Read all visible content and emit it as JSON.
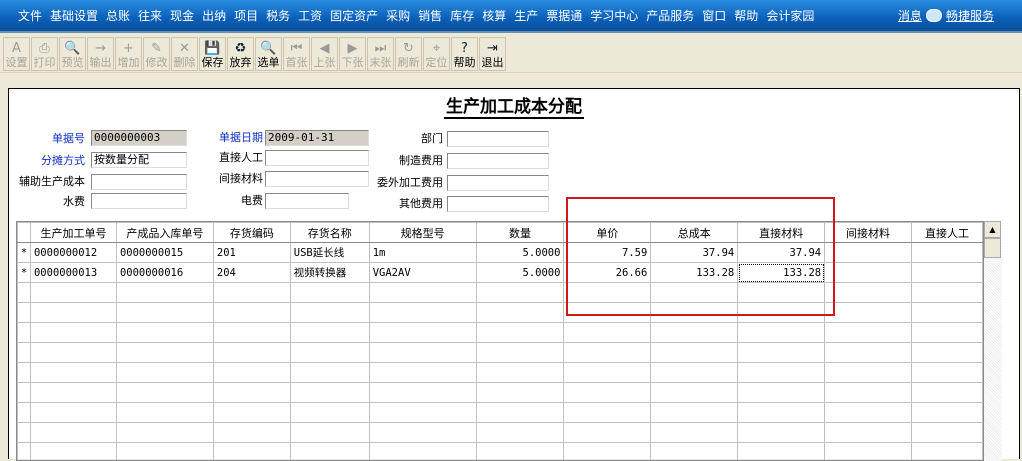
{
  "menu": [
    "文件",
    "基础设置",
    "总账",
    "往来",
    "现金",
    "出纳",
    "项目",
    "税务",
    "工资",
    "固定资产",
    "采购",
    "销售",
    "库存",
    "核算",
    "生产",
    "票据通",
    "学习中心",
    "产品服务",
    "窗口",
    "帮助",
    "会计家园"
  ],
  "menu_right": {
    "message": "消息",
    "service": "畅捷服务"
  },
  "toolbar": [
    {
      "label": "设置",
      "icon": "A",
      "enabled": false
    },
    {
      "label": "打印",
      "icon": "⎙",
      "enabled": false
    },
    {
      "label": "预览",
      "icon": "🔍",
      "enabled": false
    },
    {
      "label": "输出",
      "icon": "→",
      "enabled": false
    },
    {
      "label": "增加",
      "icon": "+",
      "enabled": false
    },
    {
      "label": "修改",
      "icon": "✎",
      "enabled": false
    },
    {
      "label": "删除",
      "icon": "✕",
      "enabled": false
    },
    {
      "label": "保存",
      "icon": "💾",
      "enabled": true
    },
    {
      "label": "放弃",
      "icon": "♻",
      "enabled": true
    },
    {
      "label": "选单",
      "icon": "🔍",
      "enabled": true
    },
    {
      "label": "首张",
      "icon": "⏮",
      "enabled": false
    },
    {
      "label": "上张",
      "icon": "◀",
      "enabled": false
    },
    {
      "label": "下张",
      "icon": "▶",
      "enabled": false
    },
    {
      "label": "末张",
      "icon": "⏭",
      "enabled": false
    },
    {
      "label": "刷新",
      "icon": "↻",
      "enabled": false
    },
    {
      "label": "定位",
      "icon": "⌖",
      "enabled": false
    },
    {
      "label": "帮助",
      "icon": "?",
      "enabled": true
    },
    {
      "label": "退出",
      "icon": "⇥",
      "enabled": true
    }
  ],
  "form": {
    "title": "生产加工成本分配",
    "doc_no_label": "单据号",
    "doc_no": "0000000003",
    "doc_date_label": "单据日期",
    "doc_date": "2009-01-31",
    "dept_label": "部门",
    "dept": "",
    "alloc_label": "分摊方式",
    "alloc": "按数量分配",
    "direct_labor_label": "直接人工",
    "direct_labor": "",
    "mfg_cost_label": "制造费用",
    "mfg_cost": "",
    "aux_cost_label": "辅助生产成本",
    "aux_cost": "",
    "indirect_mat_label": "间接材料",
    "indirect_mat": "",
    "outsource_label": "委外加工费用",
    "outsource": "",
    "water_label": "水费",
    "water": "",
    "power_label": "电费",
    "power": "",
    "other_label": "其他费用",
    "other": ""
  },
  "grid": {
    "columns": [
      "生产加工单号",
      "产成品入库单号",
      "存货编码",
      "存货名称",
      "规格型号",
      "数量",
      "单价",
      "总成本",
      "直接材料",
      "间接材料",
      "直接人工"
    ],
    "rows": [
      [
        "*",
        "0000000012",
        "0000000015",
        "201",
        "USB延长线",
        "1m",
        "5.0000",
        "7.59",
        "37.94",
        "37.94",
        "",
        ""
      ],
      [
        "*",
        "0000000013",
        "0000000016",
        "204",
        "视频转换器",
        "VGA2AV",
        "5.0000",
        "26.66",
        "133.28",
        "133.28",
        "",
        ""
      ]
    ]
  }
}
